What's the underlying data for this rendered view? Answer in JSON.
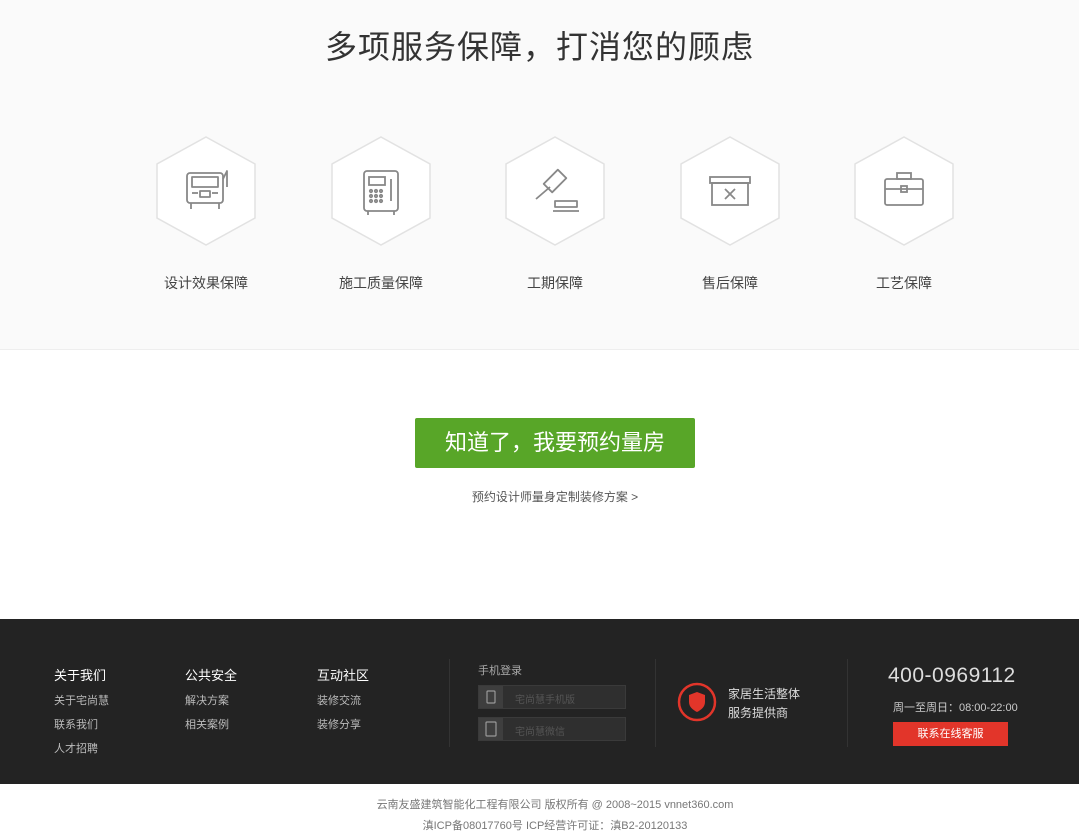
{
  "guarantee": {
    "title": "多项服务保障，打消您的顾虑",
    "items": [
      {
        "label": "设计效果保障",
        "icon": "truck-icon"
      },
      {
        "label": "施工质量保障",
        "icon": "safe-box-icon"
      },
      {
        "label": "工期保障",
        "icon": "gavel-icon"
      },
      {
        "label": "售后保障",
        "icon": "return-box-icon"
      },
      {
        "label": "工艺保障",
        "icon": "toolbox-icon"
      }
    ]
  },
  "cta": {
    "button_label": "知道了，我要预约量房",
    "sub_link": "预约设计师量身定制装修方案 >"
  },
  "footer": {
    "columns": [
      {
        "title": "关于我们",
        "links": [
          "关于宅尚慧",
          "联系我们",
          "人才招聘"
        ]
      },
      {
        "title": "公共安全",
        "links": [
          "解决方案",
          "相关案例"
        ]
      },
      {
        "title": "互动社区",
        "links": [
          "装修交流",
          "装修分享"
        ]
      }
    ],
    "login": {
      "title": "手机登录",
      "mobile_placeholder": "宅尚慧手机版",
      "wechat_placeholder": "宅尚慧微信"
    },
    "service": {
      "line1": "家居生活整体",
      "line2": "服务提供商"
    },
    "contact": {
      "phone": "400-0969112",
      "hours": "周一至周日：08:00-22:00",
      "online_button": "联系在线客服"
    },
    "copyright": "云南友盛建筑智能化工程有限公司 版权所有 @ 2008~2015 vnnet360.com",
    "icp": "滇ICP备08017760号 ICP经营许可证：滇B2-20120133"
  },
  "colors": {
    "accent_green": "#58a628",
    "accent_red": "#e2352a",
    "footer_bg": "#232323"
  }
}
